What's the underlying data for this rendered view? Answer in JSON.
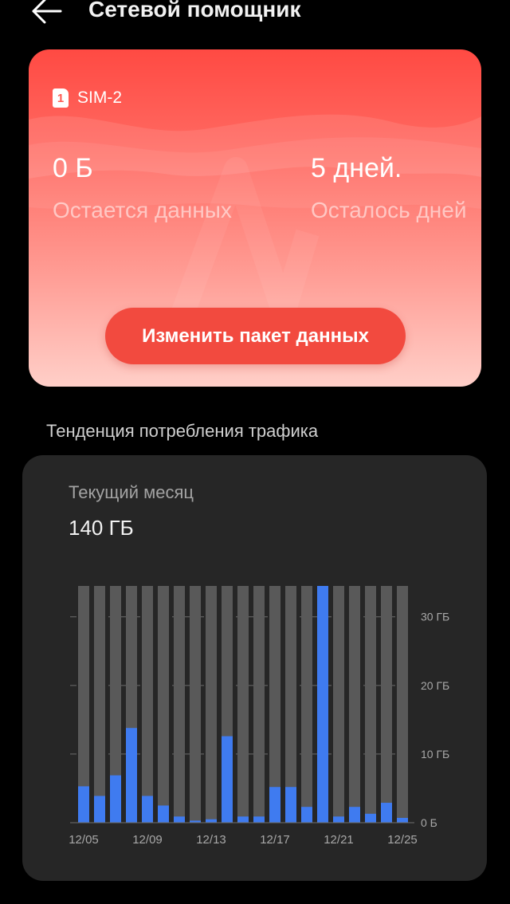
{
  "header": {
    "title": "Сетевой помощник",
    "back_icon": "arrow-left-icon"
  },
  "sim_card": {
    "sim_icon_text": "1",
    "sim_label": "SIM-2",
    "remaining_data": {
      "value": "0 Б",
      "caption": "Остается данных"
    },
    "remaining_days": {
      "value": "5 дней.",
      "caption": "Осталось дней"
    },
    "change_plan_button": "Изменить пакет данных",
    "colors": {
      "gradient_top": "#ff4a43",
      "gradient_bottom": "#ffcfc8",
      "button": "#f24a3f"
    }
  },
  "traffic": {
    "section_title": "Тенденция потребления трафика",
    "period_label": "Текущий месяц",
    "period_total": "140 ГБ"
  },
  "chart_data": {
    "type": "bar",
    "unit": "ГБ",
    "categories": [
      "12/05",
      "12/06",
      "12/07",
      "12/08",
      "12/09",
      "12/10",
      "12/11",
      "12/12",
      "12/13",
      "12/14",
      "12/15",
      "12/16",
      "12/17",
      "12/18",
      "12/19",
      "12/20",
      "12/21",
      "12/22",
      "12/23",
      "12/24",
      "12/25"
    ],
    "values": [
      5.3,
      3.9,
      6.9,
      13.8,
      3.9,
      2.5,
      0.9,
      0.3,
      0.5,
      12.6,
      0.9,
      0.9,
      5.2,
      5.2,
      2.3,
      34.5,
      0.9,
      2.3,
      1.3,
      2.9,
      0.7
    ],
    "x_tick_labels": [
      "12/05",
      "12/09",
      "12/13",
      "12/17",
      "12/21",
      "12/25"
    ],
    "y_tick_labels": [
      "0 Б",
      "10 ГБ",
      "20 ГБ",
      "30 ГБ"
    ],
    "y_ticks": [
      0,
      10,
      20,
      30
    ],
    "ylim": [
      0,
      34.5
    ],
    "grid": true,
    "colors": {
      "bar": "#3f7bf0",
      "track": "#595959",
      "grid": "#6e6e6e",
      "tick_label": "#a8a8a8"
    }
  }
}
